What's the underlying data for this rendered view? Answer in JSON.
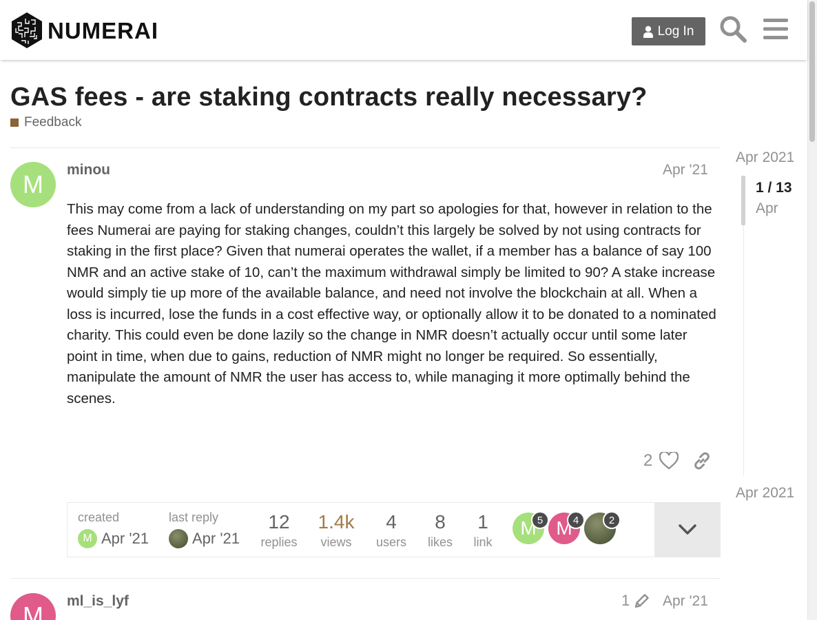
{
  "header": {
    "logo_text": "NUMERAI",
    "login_label": "Log In",
    "search_icon": "search-icon",
    "menu_icon": "hamburger-menu-icon"
  },
  "topic": {
    "title": "GAS fees - are staking contracts really necessary?",
    "category": "Feedback",
    "category_color": "#8c6238"
  },
  "post1": {
    "avatar_letter": "M",
    "avatar_color": "#a6e07c",
    "username": "minou",
    "date": "Apr '21",
    "body": "This may come from a lack of understanding on my part so apologies for that, however in relation to the fees Numerai are paying for staking changes, couldn’t this largely be solved by not using contracts for staking in the first place? Given that numerai operates the wallet, if a member has a balance of say 100 NMR and an active stake of 10, can’t the maximum withdrawal simply be limited to 90? A stake increase would simply tie up more of the available balance, and need not involve the blockchain at all. When a loss is incurred, lose the funds in a cost effective way, or optionally allow it to be donated to a nominated charity. This could even be done lazily so the change in NMR doesn’t actually occur until some later point in time, when due to gains, reduction of NMR might no longer be required. So essentially, manipulate the amount of NMR the user has access to, while managing it more optimally behind the scenes.",
    "likes": "2"
  },
  "topic_map": {
    "created_label": "created",
    "created_date": "Apr '21",
    "last_reply_label": "last reply",
    "last_reply_date": "Apr '21",
    "stats": [
      {
        "value": "12",
        "label": "replies"
      },
      {
        "value": "1.4k",
        "label": "views"
      },
      {
        "value": "4",
        "label": "users"
      },
      {
        "value": "8",
        "label": "likes"
      },
      {
        "value": "1",
        "label": "link"
      }
    ],
    "participants": [
      {
        "letter": "M",
        "color": "#a6e07c",
        "count": "5"
      },
      {
        "letter": "M",
        "color": "#e05a8a",
        "count": "4"
      },
      {
        "letter": "",
        "color": "#4e5a3a",
        "count": "2"
      }
    ]
  },
  "post2": {
    "avatar_letter": "M",
    "avatar_color": "#e05a8a",
    "username": "ml_is_lyf",
    "edit_count": "1",
    "date": "Apr '21"
  },
  "timeline": {
    "start_date": "Apr 2021",
    "counter": "1 / 13",
    "sub": "Apr",
    "end_date": "Apr 2021"
  }
}
